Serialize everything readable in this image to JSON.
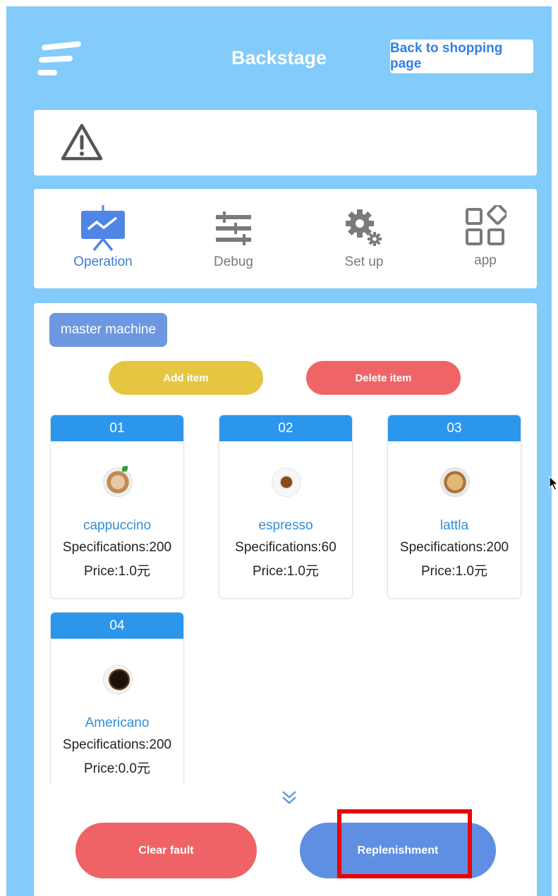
{
  "header": {
    "title": "Backstage",
    "back_label": "Back to shopping page"
  },
  "tabs": [
    {
      "label": "Operation",
      "icon": "operation-board-icon",
      "active": true
    },
    {
      "label": "Debug",
      "icon": "sliders-icon",
      "active": false
    },
    {
      "label": "Set up",
      "icon": "gears-icon",
      "active": false
    },
    {
      "label": "app",
      "icon": "apps-grid-icon",
      "active": false
    }
  ],
  "machine": {
    "master_label": "master machine",
    "add_label": "Add item",
    "delete_label": "Delete item"
  },
  "items": [
    {
      "number": "01",
      "name": "cappuccino",
      "spec": "Specifications:200",
      "price": "Price:1.0元"
    },
    {
      "number": "02",
      "name": "espresso",
      "spec": "Specifications:60",
      "price": "Price:1.0元"
    },
    {
      "number": "03",
      "name": "lattla",
      "spec": "Specifications:200",
      "price": "Price:1.0元"
    },
    {
      "number": "04",
      "name": "Americano",
      "spec": "Specifications:200",
      "price": "Price:0.0元"
    }
  ],
  "actions": {
    "clear_label": "Clear fault",
    "replenish_label": "Replenishment"
  },
  "colors": {
    "background": "#82cbfa",
    "item_header": "#2b96ec",
    "item_name": "#2f8fd8",
    "add": "#e6c641",
    "delete": "#ef6567",
    "clear": "#ef6266",
    "replenish": "#5f8fe2",
    "highlight": "#ee0000"
  }
}
